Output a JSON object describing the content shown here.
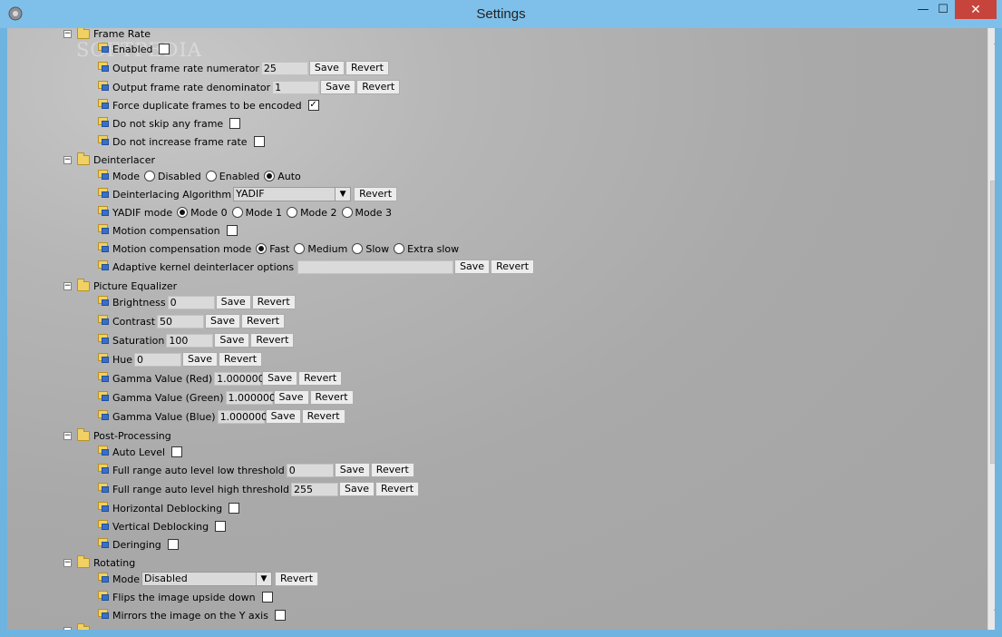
{
  "window": {
    "title": "Settings",
    "close_glyph": "✕",
    "min_glyph": "—",
    "max_glyph": "☐"
  },
  "scroll": {
    "up": "⌃",
    "down": "⌄"
  },
  "watermark": "SOFTPEDIA",
  "sections": [
    {
      "label": "Frame Rate",
      "expander": "−"
    },
    {
      "label": "Deinterlacer",
      "expander": "−"
    },
    {
      "label": "Picture Equalizer",
      "expander": "−"
    },
    {
      "label": "Post-Processing",
      "expander": "−"
    },
    {
      "label": "Rotating",
      "expander": "−"
    }
  ],
  "buttons": {
    "save": "Save",
    "revert": "Revert"
  },
  "frame_rate": {
    "enabled": "Enabled",
    "numerator_label": "Output frame rate numerator",
    "numerator": "25",
    "denominator_label": "Output frame rate denominator",
    "denominator": "1",
    "force_dup": "Force duplicate frames to be encoded",
    "force_dup_check": "✓",
    "no_skip": "Do not skip any frame",
    "no_increase": "Do not increase frame rate"
  },
  "deinterlacer": {
    "mode_label": "Mode",
    "mode_opts": [
      "Disabled",
      "Enabled",
      "Auto"
    ],
    "algo_label": "Deinterlacing Algorithm",
    "algo_value": "YADIF",
    "yadif_label": "YADIF mode",
    "yadif_opts": [
      "Mode 0",
      "Mode 1",
      "Mode 2",
      "Mode 3"
    ],
    "motion_comp": "Motion compensation",
    "motion_mode_label": "Motion compensation mode",
    "motion_opts": [
      "Fast",
      "Medium",
      "Slow",
      "Extra slow"
    ],
    "adaptive_label": "Adaptive kernel deinterlacer options",
    "adaptive_value": ""
  },
  "equalizer": {
    "brightness_label": "Brightness",
    "brightness": "0",
    "contrast_label": "Contrast",
    "contrast": "50",
    "saturation_label": "Saturation",
    "saturation": "100",
    "hue_label": "Hue",
    "hue": "0",
    "gamma_red_label": "Gamma Value (Red)",
    "gamma_red": "1.000000",
    "gamma_green_label": "Gamma Value (Green)",
    "gamma_green": "1.000000",
    "gamma_blue_label": "Gamma Value (Blue)",
    "gamma_blue": "1.000000"
  },
  "postproc": {
    "auto_level": "Auto Level",
    "low_label": "Full range auto level low threshold",
    "low": "0",
    "high_label": "Full range auto level high threshold",
    "high": "255",
    "hdeblock": "Horizontal Deblocking",
    "vdeblock": "Vertical Deblocking",
    "deringing": "Deringing"
  },
  "rotating": {
    "mode_label": "Mode",
    "mode_value": "Disabled",
    "flip": "Flips the image upside down",
    "mirror": "Mirrors the image on the Y axis"
  },
  "colors": {
    "titlebar": "#7ec0ea",
    "close": "#c7443c",
    "folder": "#f1d164"
  }
}
